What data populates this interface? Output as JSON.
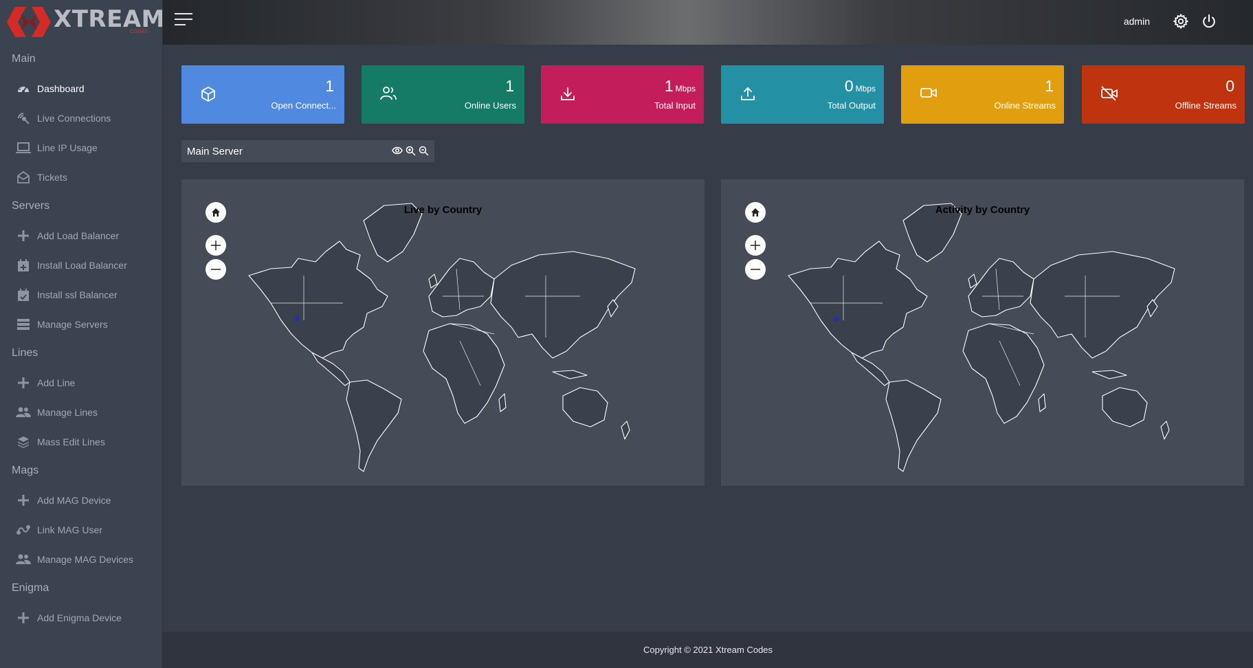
{
  "brand": {
    "name": "XTREAM",
    "sub": "CODES"
  },
  "sidebar": {
    "sections": [
      {
        "title": "Main",
        "items": [
          {
            "label": "Dashboard",
            "icon": "dashboard-icon",
            "active": true
          },
          {
            "label": "Live Connections",
            "icon": "connections-icon"
          },
          {
            "label": "Line IP Usage",
            "icon": "laptop-icon"
          },
          {
            "label": "Tickets",
            "icon": "envelope-open-icon"
          }
        ]
      },
      {
        "title": "Servers",
        "items": [
          {
            "label": "Add Load Balancer",
            "icon": "plus-icon"
          },
          {
            "label": "Install Load Balancer",
            "icon": "calendar-plus-icon"
          },
          {
            "label": "Install ssl Balancer",
            "icon": "calendar-check-icon"
          },
          {
            "label": "Manage Servers",
            "icon": "server-icon"
          }
        ]
      },
      {
        "title": "Lines",
        "items": [
          {
            "label": "Add Line",
            "icon": "plus-icon"
          },
          {
            "label": "Manage Lines",
            "icon": "users-icon"
          },
          {
            "label": "Mass Edit Lines",
            "icon": "layers-icon"
          }
        ]
      },
      {
        "title": "Mags",
        "items": [
          {
            "label": "Add MAG Device",
            "icon": "plus-icon"
          },
          {
            "label": "Link MAG User",
            "icon": "link-icon"
          },
          {
            "label": "Manage MAG Devices",
            "icon": "users-icon"
          }
        ]
      },
      {
        "title": "Enigma",
        "items": [
          {
            "label": "Add Enigma Device",
            "icon": "plus-icon"
          }
        ]
      }
    ]
  },
  "topbar": {
    "user": "admin"
  },
  "cards": [
    {
      "value": "1",
      "unit": "",
      "label": "Open Connect...",
      "color": "#4f8ae0",
      "icon": "cube-icon"
    },
    {
      "value": "1",
      "unit": "",
      "label": "Online Users",
      "color": "#157a66",
      "icon": "users-icon"
    },
    {
      "value": "1",
      "unit": "Mbps",
      "label": "Total Input",
      "color": "#c41d5c",
      "icon": "download-icon"
    },
    {
      "value": "0",
      "unit": "Mbps",
      "label": "Total Output",
      "color": "#2390a3",
      "icon": "upload-icon"
    },
    {
      "value": "1",
      "unit": "",
      "label": "Online Streams",
      "color": "#e19f10",
      "icon": "video-icon"
    },
    {
      "value": "0",
      "unit": "",
      "label": "Offline Streams",
      "color": "#c0330f",
      "icon": "video-off-icon"
    }
  ],
  "server": {
    "name": "Main Server"
  },
  "maps": [
    {
      "title": "Live by Country"
    },
    {
      "title": "Activity by Country"
    }
  ],
  "footer": "Copyright © 2021 Xtream Codes"
}
